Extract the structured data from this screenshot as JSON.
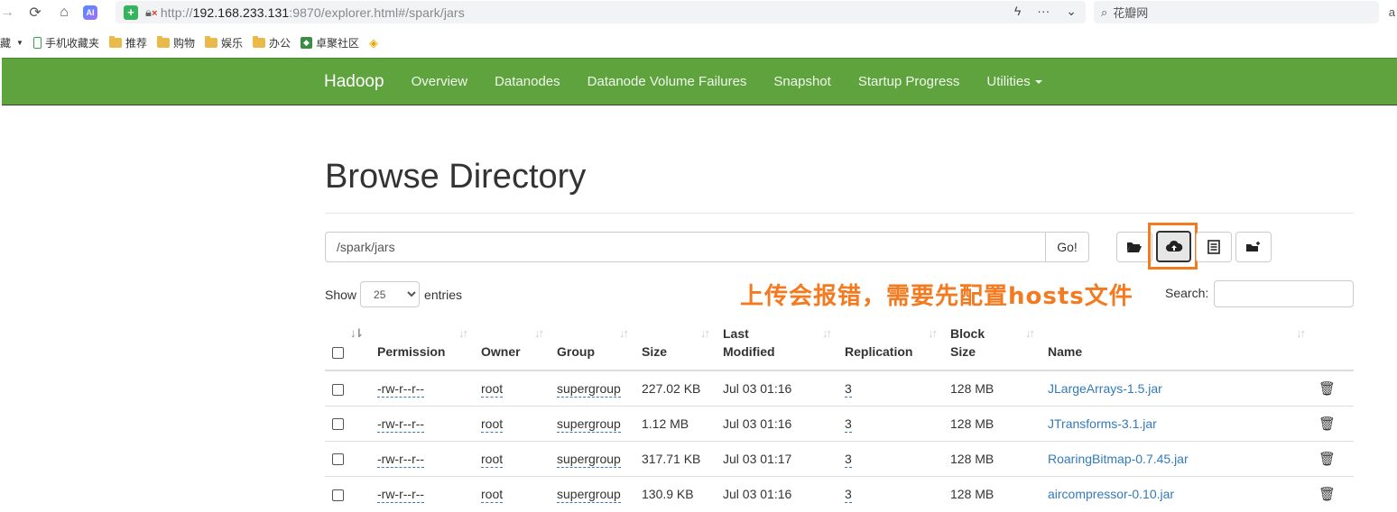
{
  "browser": {
    "url_prefix": "http://",
    "url_host": "192.168.233.131",
    "url_rest": ":9870/explorer.html#/spark/jars",
    "search_placeholder": "花瓣网",
    "ai_label": "AI"
  },
  "bookmarks": [
    {
      "label": "藏",
      "icon": "star-icon"
    },
    {
      "label": "手机收藏夹",
      "icon": "phone-icon"
    },
    {
      "label": "推荐",
      "icon": "folder-icon"
    },
    {
      "label": "购物",
      "icon": "folder-icon"
    },
    {
      "label": "娱乐",
      "icon": "folder-icon"
    },
    {
      "label": "办公",
      "icon": "folder-icon"
    },
    {
      "label": "卓聚社区",
      "icon": "android-icon"
    }
  ],
  "navbar": {
    "brand": "Hadoop",
    "links": [
      "Overview",
      "Datanodes",
      "Datanode Volume Failures",
      "Snapshot",
      "Startup Progress",
      "Utilities"
    ]
  },
  "page": {
    "title": "Browse Directory",
    "path_value": "/spark/jars",
    "go_label": "Go!",
    "show_label": "Show",
    "entries_value": "25",
    "entries_label": "entries",
    "search_label": "Search:",
    "annotation": "上传会报错，需要先配置hosts文件"
  },
  "table": {
    "headers": {
      "permission": "Permission",
      "owner": "Owner",
      "group": "Group",
      "size": "Size",
      "last_modified_1": "Last",
      "last_modified_2": "Modified",
      "replication": "Replication",
      "block_size_1": "Block",
      "block_size_2": "Size",
      "name": "Name"
    },
    "rows": [
      {
        "permission": "-rw-r--r--",
        "owner": "root",
        "group": "supergroup",
        "size": "227.02 KB",
        "modified": "Jul 03 01:16",
        "replication": "3",
        "block_size": "128 MB",
        "name": "JLargeArrays-1.5.jar"
      },
      {
        "permission": "-rw-r--r--",
        "owner": "root",
        "group": "supergroup",
        "size": "1.12 MB",
        "modified": "Jul 03 01:16",
        "replication": "3",
        "block_size": "128 MB",
        "name": "JTransforms-3.1.jar"
      },
      {
        "permission": "-rw-r--r--",
        "owner": "root",
        "group": "supergroup",
        "size": "317.71 KB",
        "modified": "Jul 03 01:17",
        "replication": "3",
        "block_size": "128 MB",
        "name": "RoaringBitmap-0.7.45.jar"
      },
      {
        "permission": "-rw-r--r--",
        "owner": "root",
        "group": "supergroup",
        "size": "130.9 KB",
        "modified": "Jul 03 01:16",
        "replication": "3",
        "block_size": "128 MB",
        "name": "aircompressor-0.10.jar"
      }
    ]
  },
  "colors": {
    "navbar": "#5fa33e",
    "highlight": "#f47a20",
    "link": "#337ab7"
  }
}
